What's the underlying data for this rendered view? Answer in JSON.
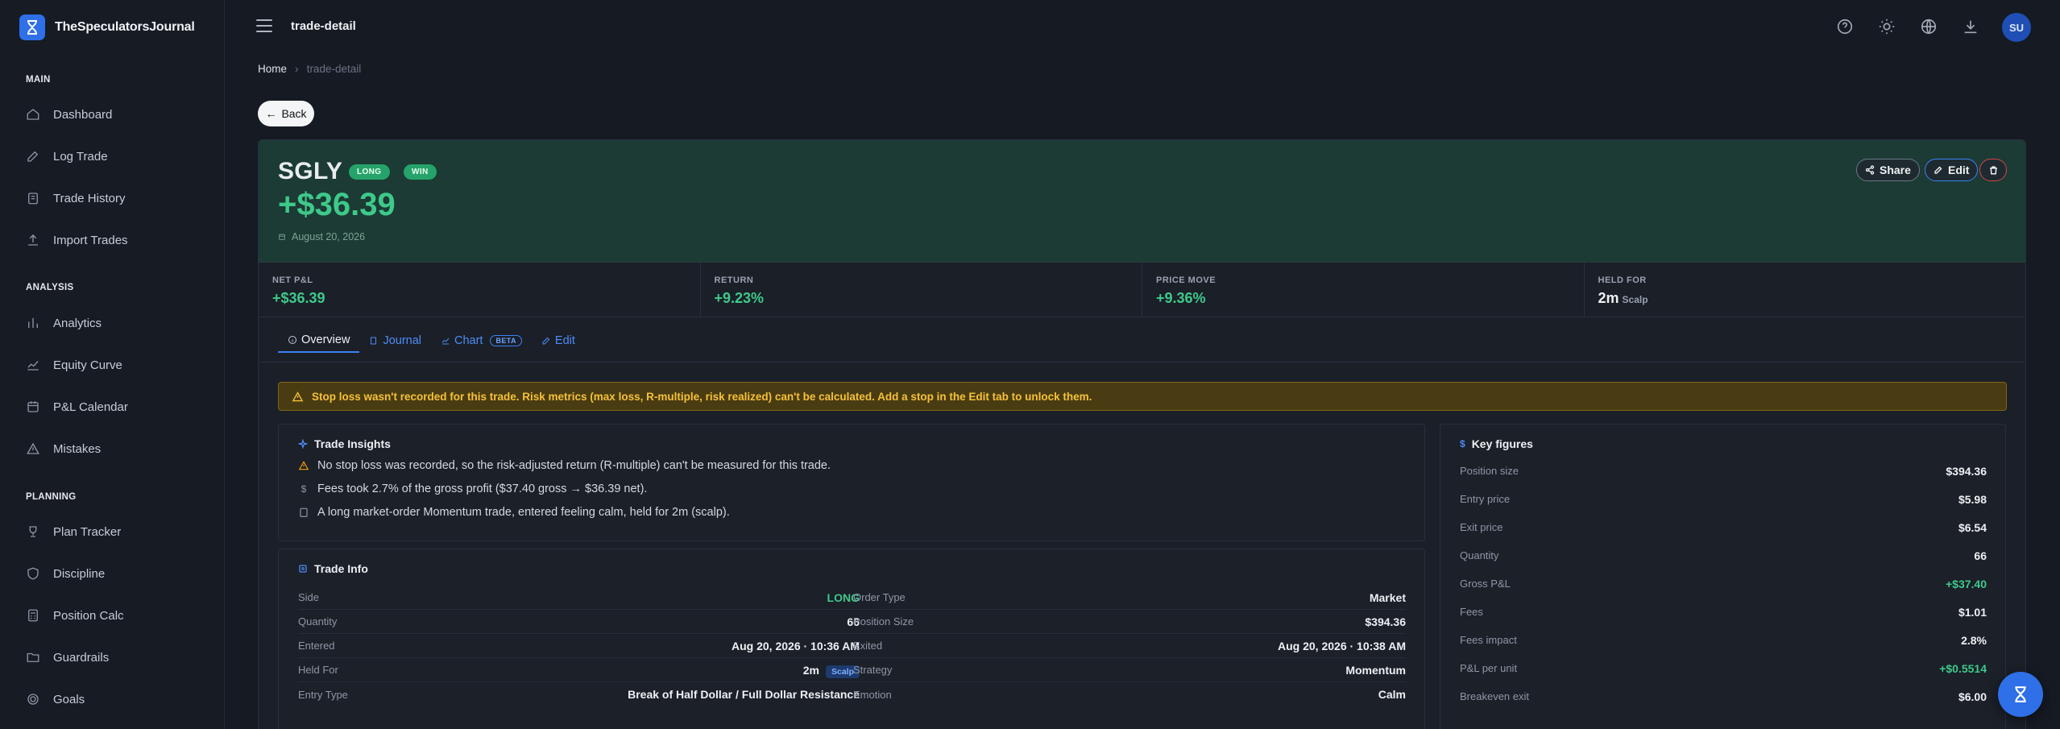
{
  "app": {
    "name": "TheSpeculatorsJournal",
    "page_title": "trade-detail",
    "avatar_initials": "SU"
  },
  "sidebar": {
    "sections": [
      {
        "label": "MAIN",
        "items": [
          "Dashboard",
          "Log Trade",
          "Trade History",
          "Import Trades"
        ]
      },
      {
        "label": "ANALYSIS",
        "items": [
          "Analytics",
          "Equity Curve",
          "P&L Calendar",
          "Mistakes"
        ]
      },
      {
        "label": "PLANNING",
        "items": [
          "Plan Tracker",
          "Discipline",
          "Position Calc",
          "Guardrails",
          "Goals"
        ]
      }
    ]
  },
  "breadcrumb": {
    "home": "Home",
    "current": "trade-detail"
  },
  "back_label": "Back",
  "trade": {
    "ticker": "SGLY",
    "side_badge": "LONG",
    "result_badge": "WIN",
    "pnl": "+$36.39",
    "date": "August 20, 2026"
  },
  "actions": {
    "share": "Share",
    "edit": "Edit"
  },
  "stats": [
    {
      "label": "NET P&L",
      "value": "+$36.39"
    },
    {
      "label": "RETURN",
      "value": "+9.23%"
    },
    {
      "label": "PRICE MOVE",
      "value": "+9.36%"
    },
    {
      "label": "HELD FOR",
      "value": "2m",
      "sub": "Scalp"
    }
  ],
  "tabs": {
    "overview": "Overview",
    "journal": "Journal",
    "chart": "Chart",
    "chart_badge": "BETA",
    "edit": "Edit"
  },
  "warning": "Stop loss wasn't recorded for this trade. Risk metrics (max loss, R-multiple, risk realized) can't be calculated. Add a stop in the Edit tab to unlock them.",
  "insights": {
    "title": "Trade Insights",
    "items": [
      "No stop loss was recorded, so the risk-adjusted return (R-multiple) can't be measured for this trade.",
      "Fees took 2.7% of the gross profit ($37.40 gross → $36.39 net).",
      "A long market-order Momentum trade, entered feeling calm, held for 2m (scalp)."
    ]
  },
  "trade_info": {
    "title": "Trade Info",
    "left": [
      {
        "k": "Side",
        "v": "LONG"
      },
      {
        "k": "Quantity",
        "v": "66"
      },
      {
        "k": "Entered",
        "v": "Aug 20, 2026 · 10:36 AM"
      },
      {
        "k": "Held For",
        "v": "2m",
        "tag": "Scalp"
      },
      {
        "k": "Entry Type",
        "v": "Break of Half Dollar / Full Dollar Resistance"
      }
    ],
    "right": [
      {
        "k": "Order Type",
        "v": "Market"
      },
      {
        "k": "Position Size",
        "v": "$394.36"
      },
      {
        "k": "Exited",
        "v": "Aug 20, 2026 · 10:38 AM"
      },
      {
        "k": "Strategy",
        "v": "Momentum"
      },
      {
        "k": "Emotion",
        "v": "Calm"
      }
    ]
  },
  "key_figures": {
    "title": "Key figures",
    "rows": [
      {
        "k": "Position size",
        "v": "$394.36"
      },
      {
        "k": "Entry price",
        "v": "$5.98"
      },
      {
        "k": "Exit price",
        "v": "$6.54"
      },
      {
        "k": "Quantity",
        "v": "66"
      },
      {
        "k": "Gross P&L",
        "v": "+$37.40"
      },
      {
        "k": "Fees",
        "v": "$1.01"
      },
      {
        "k": "Fees impact",
        "v": "2.8%"
      },
      {
        "k": "P&L per unit",
        "v": "+$0.5514"
      },
      {
        "k": "Breakeven exit",
        "v": "$6.00"
      }
    ]
  },
  "colors": {
    "accent": "#2f6fe8",
    "profit": "#3ec98a",
    "warning": "#f5c13a"
  }
}
